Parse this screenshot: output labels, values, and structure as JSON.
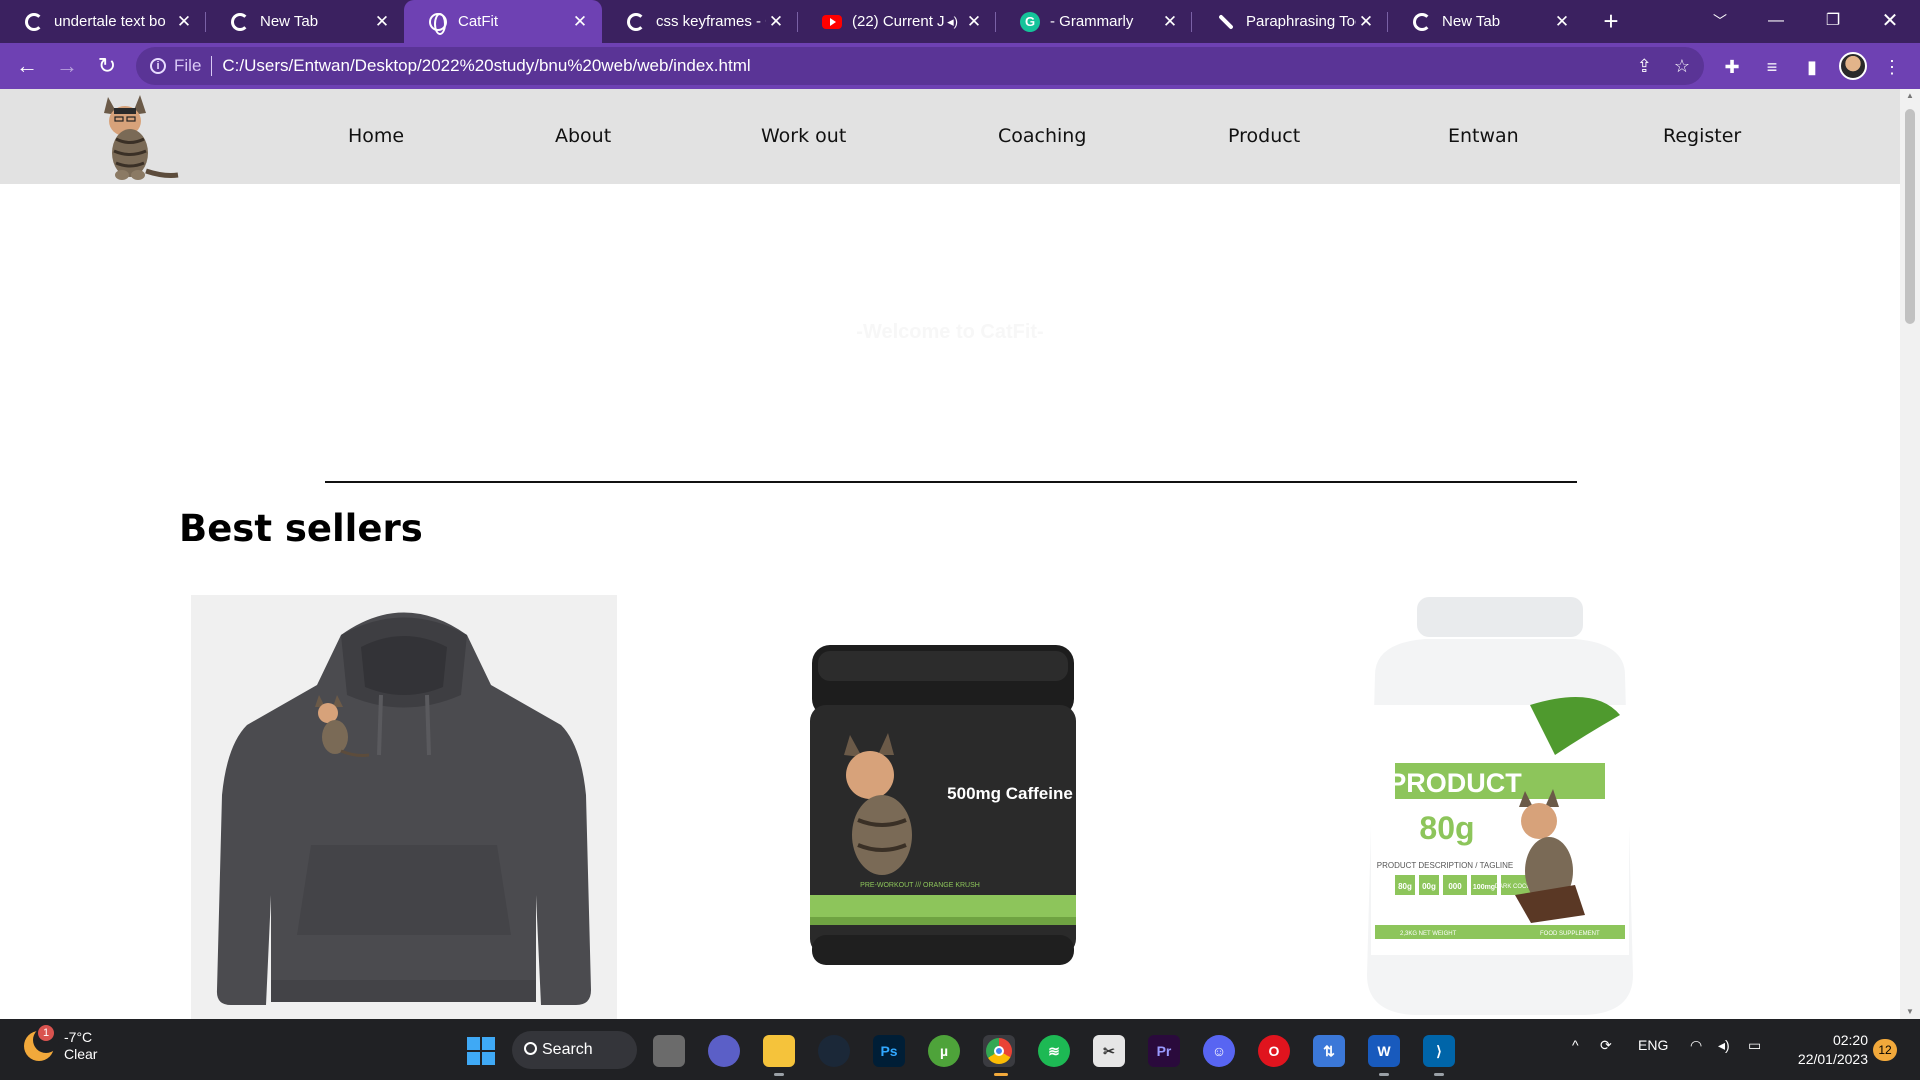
{
  "browser": {
    "tabs": [
      {
        "title": "undertale text bo",
        "icon": "google-icon"
      },
      {
        "title": "New Tab",
        "icon": "chrome-icon"
      },
      {
        "title": "CatFit",
        "icon": "globe-icon",
        "active": true
      },
      {
        "title": "css keyframes - G",
        "icon": "google-icon"
      },
      {
        "title": "(22) Current J",
        "icon": "youtube-icon",
        "audio": true
      },
      {
        "title": "- Grammarly",
        "icon": "grammarly-icon"
      },
      {
        "title": "Paraphrasing Too",
        "icon": "quill-icon"
      },
      {
        "title": "New Tab",
        "icon": "chrome-icon"
      }
    ],
    "address": {
      "scheme_label": "File",
      "url": "C:/Users/Entwan/Desktop/2022%20study/bnu%20web/web/index.html"
    }
  },
  "site": {
    "nav": [
      "Home",
      "About",
      "Work out",
      "Coaching",
      "Product",
      "Entwan",
      "Register"
    ],
    "welcome": "-Welcome to CatFit-",
    "section_title": "Best sellers",
    "products": {
      "preworkout": {
        "caption": "500mg Caffeine",
        "flavor": "PRE-WORKOUT /// ORANGE KRUSH"
      },
      "protein": {
        "brand": "PRODUCT",
        "amount": "80g",
        "tagline": "PRODUCT DESCRIPTION / TAGLINE",
        "stats": [
          "80g",
          "00g",
          "000",
          "100mg"
        ],
        "flavor": "DARK COCOA POWDER",
        "weight": "2,3KG NET WEIGHT",
        "type": "FOOD SUPPLEMENT"
      }
    }
  },
  "taskbar": {
    "weather_temp": "-7°C",
    "weather_desc": "Clear",
    "weather_badge": "1",
    "search": "Search",
    "language": "ENG",
    "time": "02:20",
    "date": "22/01/2023",
    "notifications": "12"
  },
  "colors": {
    "tabstrip": "#3b2160",
    "toolbar": "#6e41b3",
    "site_nav": "#e2e2e2"
  }
}
